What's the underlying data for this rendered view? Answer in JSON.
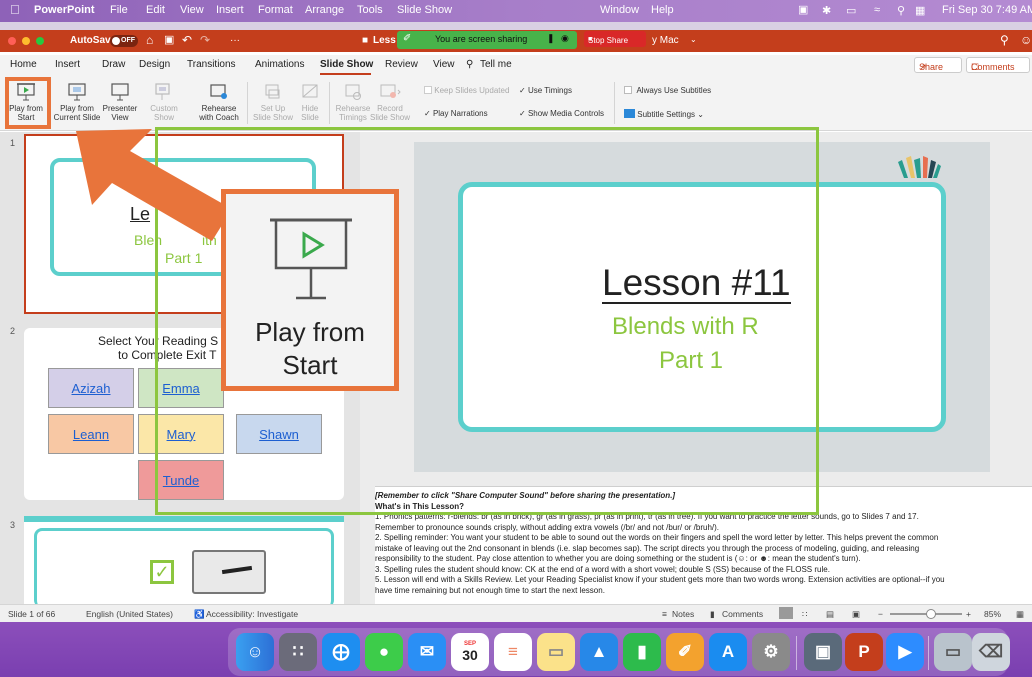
{
  "menubar": {
    "app_name": "PowerPoint",
    "menus": [
      "File",
      "Edit",
      "View",
      "Insert",
      "Format",
      "Arrange",
      "Tools",
      "Slide Show"
    ],
    "window_menu": "Window",
    "help_menu": "Help",
    "datetime": "Fri Sep 30  7:49 AM"
  },
  "titlebar": {
    "autosave_label": "AutoSave",
    "autosave_state": "OFF",
    "more": "···",
    "doc_title": "Less",
    "doc_location": "y Mac",
    "sharing_banner": "You are screen sharing",
    "stop_share_label": "Stop Share"
  },
  "tabs": [
    "Home",
    "Insert",
    "Draw",
    "Design",
    "Transitions",
    "Animations",
    "Slide Show",
    "Review",
    "View"
  ],
  "tell_me": "Tell me",
  "share_label": "Share",
  "comments_label": "Comments",
  "ribbon": {
    "play_from_start": [
      "Play from",
      "Start"
    ],
    "play_from_current": [
      "Play from",
      "Current Slide"
    ],
    "presenter_view": [
      "Presenter",
      "View"
    ],
    "custom_show": [
      "Custom",
      "Show"
    ],
    "rehearse_coach": [
      "Rehearse",
      "with Coach"
    ],
    "setup_slideshow": [
      "Set Up",
      "Slide Show"
    ],
    "hide_slide": [
      "Hide",
      "Slide"
    ],
    "rehearse_timings": [
      "Rehearse",
      "Timings"
    ],
    "record_slideshow": [
      "Record",
      "Slide Show"
    ],
    "keep_slides_updated": "Keep Slides Updated",
    "use_timings": "Use Timings",
    "play_narrations": "Play Narrations",
    "show_media_controls": "Show Media Controls",
    "always_use_subtitles": "Always Use Subtitles",
    "subtitle_settings": "Subtitle Settings"
  },
  "callout": {
    "line1": "Play from",
    "line2": "Start"
  },
  "slide1": {
    "number": "1",
    "title": "Lesson #11",
    "subtitle1": "Blends with R",
    "subtitle2": "Part 1",
    "thumb_title_fragment": "Le",
    "thumb_sub1_fragment": "Blen",
    "thumb_sub1_end": "ith",
    "thumb_sub2": "Part 1"
  },
  "slide2": {
    "number": "2",
    "title_line1": "Select Your Reading S",
    "title_line2": "to Complete Exit T",
    "names": [
      "Azizah",
      "Emma",
      "Leann",
      "Mary",
      "Shawn",
      "Tunde"
    ]
  },
  "slide3": {
    "number": "3"
  },
  "notes": {
    "line1": "[Remember to click \"Share Computer Sound\" before sharing the presentation.]",
    "line2": "What's in This Lesson?",
    "items": [
      "1. Phonics patterns: r-blends: br (as in brick), gr (as in grass), pr (as in print), tr (as in tree). If you want to practice the letter sounds, go to Slides 7 and 17.",
      "    Remember to pronounce sounds crisply, without adding extra vowels (/br/ and not /bur/ or /bruh/).",
      "2. Spelling reminder: You want your student to be able to sound out the words on their fingers and spell the word letter by letter. This helps prevent the common",
      "    mistake of leaving out the 2nd consonant in blends (i.e. slap becomes sap). The script directs you through the process of modeling, guiding, and releasing",
      "    responsibility to the student. Pay close attention to whether you are doing something or the student is (☺: or ☻: mean the student's turn).",
      "3. Spelling rules the student should know: CK at the end of a word with a short vowel; double S (SS) because of the FLOSS rule.",
      "5. Lesson will end with a Skills Review. Let your Reading Specialist know if your student gets more than two words wrong. Extension activities are optional--if you",
      "    have time remaining but not enough time to start the next lesson."
    ]
  },
  "status": {
    "slide_of": "Slide 1 of 66",
    "language": "English (United States)",
    "accessibility": "Accessibility: Investigate",
    "notes_label": "Notes",
    "comments_label": "Comments",
    "zoom": "85%"
  },
  "dock": {
    "calendar_month": "SEP",
    "calendar_day": "30"
  },
  "colors": {
    "accent_orange": "#e8743b",
    "slide_teal": "#5ccfcc",
    "slide_green": "#8cc63f",
    "powerpoint_red": "#c43e1c"
  }
}
